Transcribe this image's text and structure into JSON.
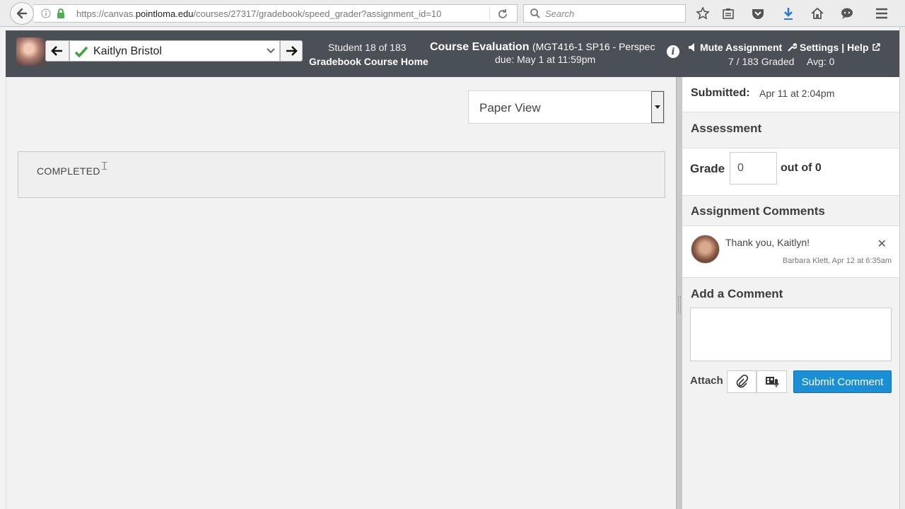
{
  "browser": {
    "url_prefix": "https://canvas.",
    "url_domain": "pointloma.edu",
    "url_suffix": "/courses/27317/gradebook/speed_grader?assignment_id=10",
    "search_placeholder": "Search"
  },
  "header": {
    "student_name": "Kaitlyn Bristol",
    "student_count": "Student 18 of 183",
    "gradebook_link": "Gradebook Course Home",
    "assignment_title": "Course Evaluation",
    "course_name": "(MGT416-1 SP16 - Perspec",
    "due_date": "due: May 1 at 11:59pm",
    "mute_label": "Mute Assignment",
    "settings_label": "Settings",
    "help_label": "Help",
    "graded_count": "7 / 183 Graded",
    "average": "Avg: 0"
  },
  "content": {
    "view_selected": "Paper View",
    "submission_text": "COMPLETED"
  },
  "sidebar": {
    "submitted_label": "Submitted:",
    "submitted_value": "Apr 11 at 2:04pm",
    "assessment_heading": "Assessment",
    "grade_label": "Grade",
    "grade_value": "0",
    "out_of_label": "out of 0",
    "comments_heading": "Assignment Comments",
    "comment_text": "Thank you, Kaitlyn!",
    "comment_meta": "Barbara Klett, Apr 12 at 6:35am",
    "add_comment_heading": "Add a Comment",
    "attach_label": "Attach",
    "submit_label": "Submit Comment"
  },
  "colors": {
    "header_bg": "#4b4f56",
    "submit_button": "#1b8fd6",
    "check_green": "#3ca33c"
  }
}
